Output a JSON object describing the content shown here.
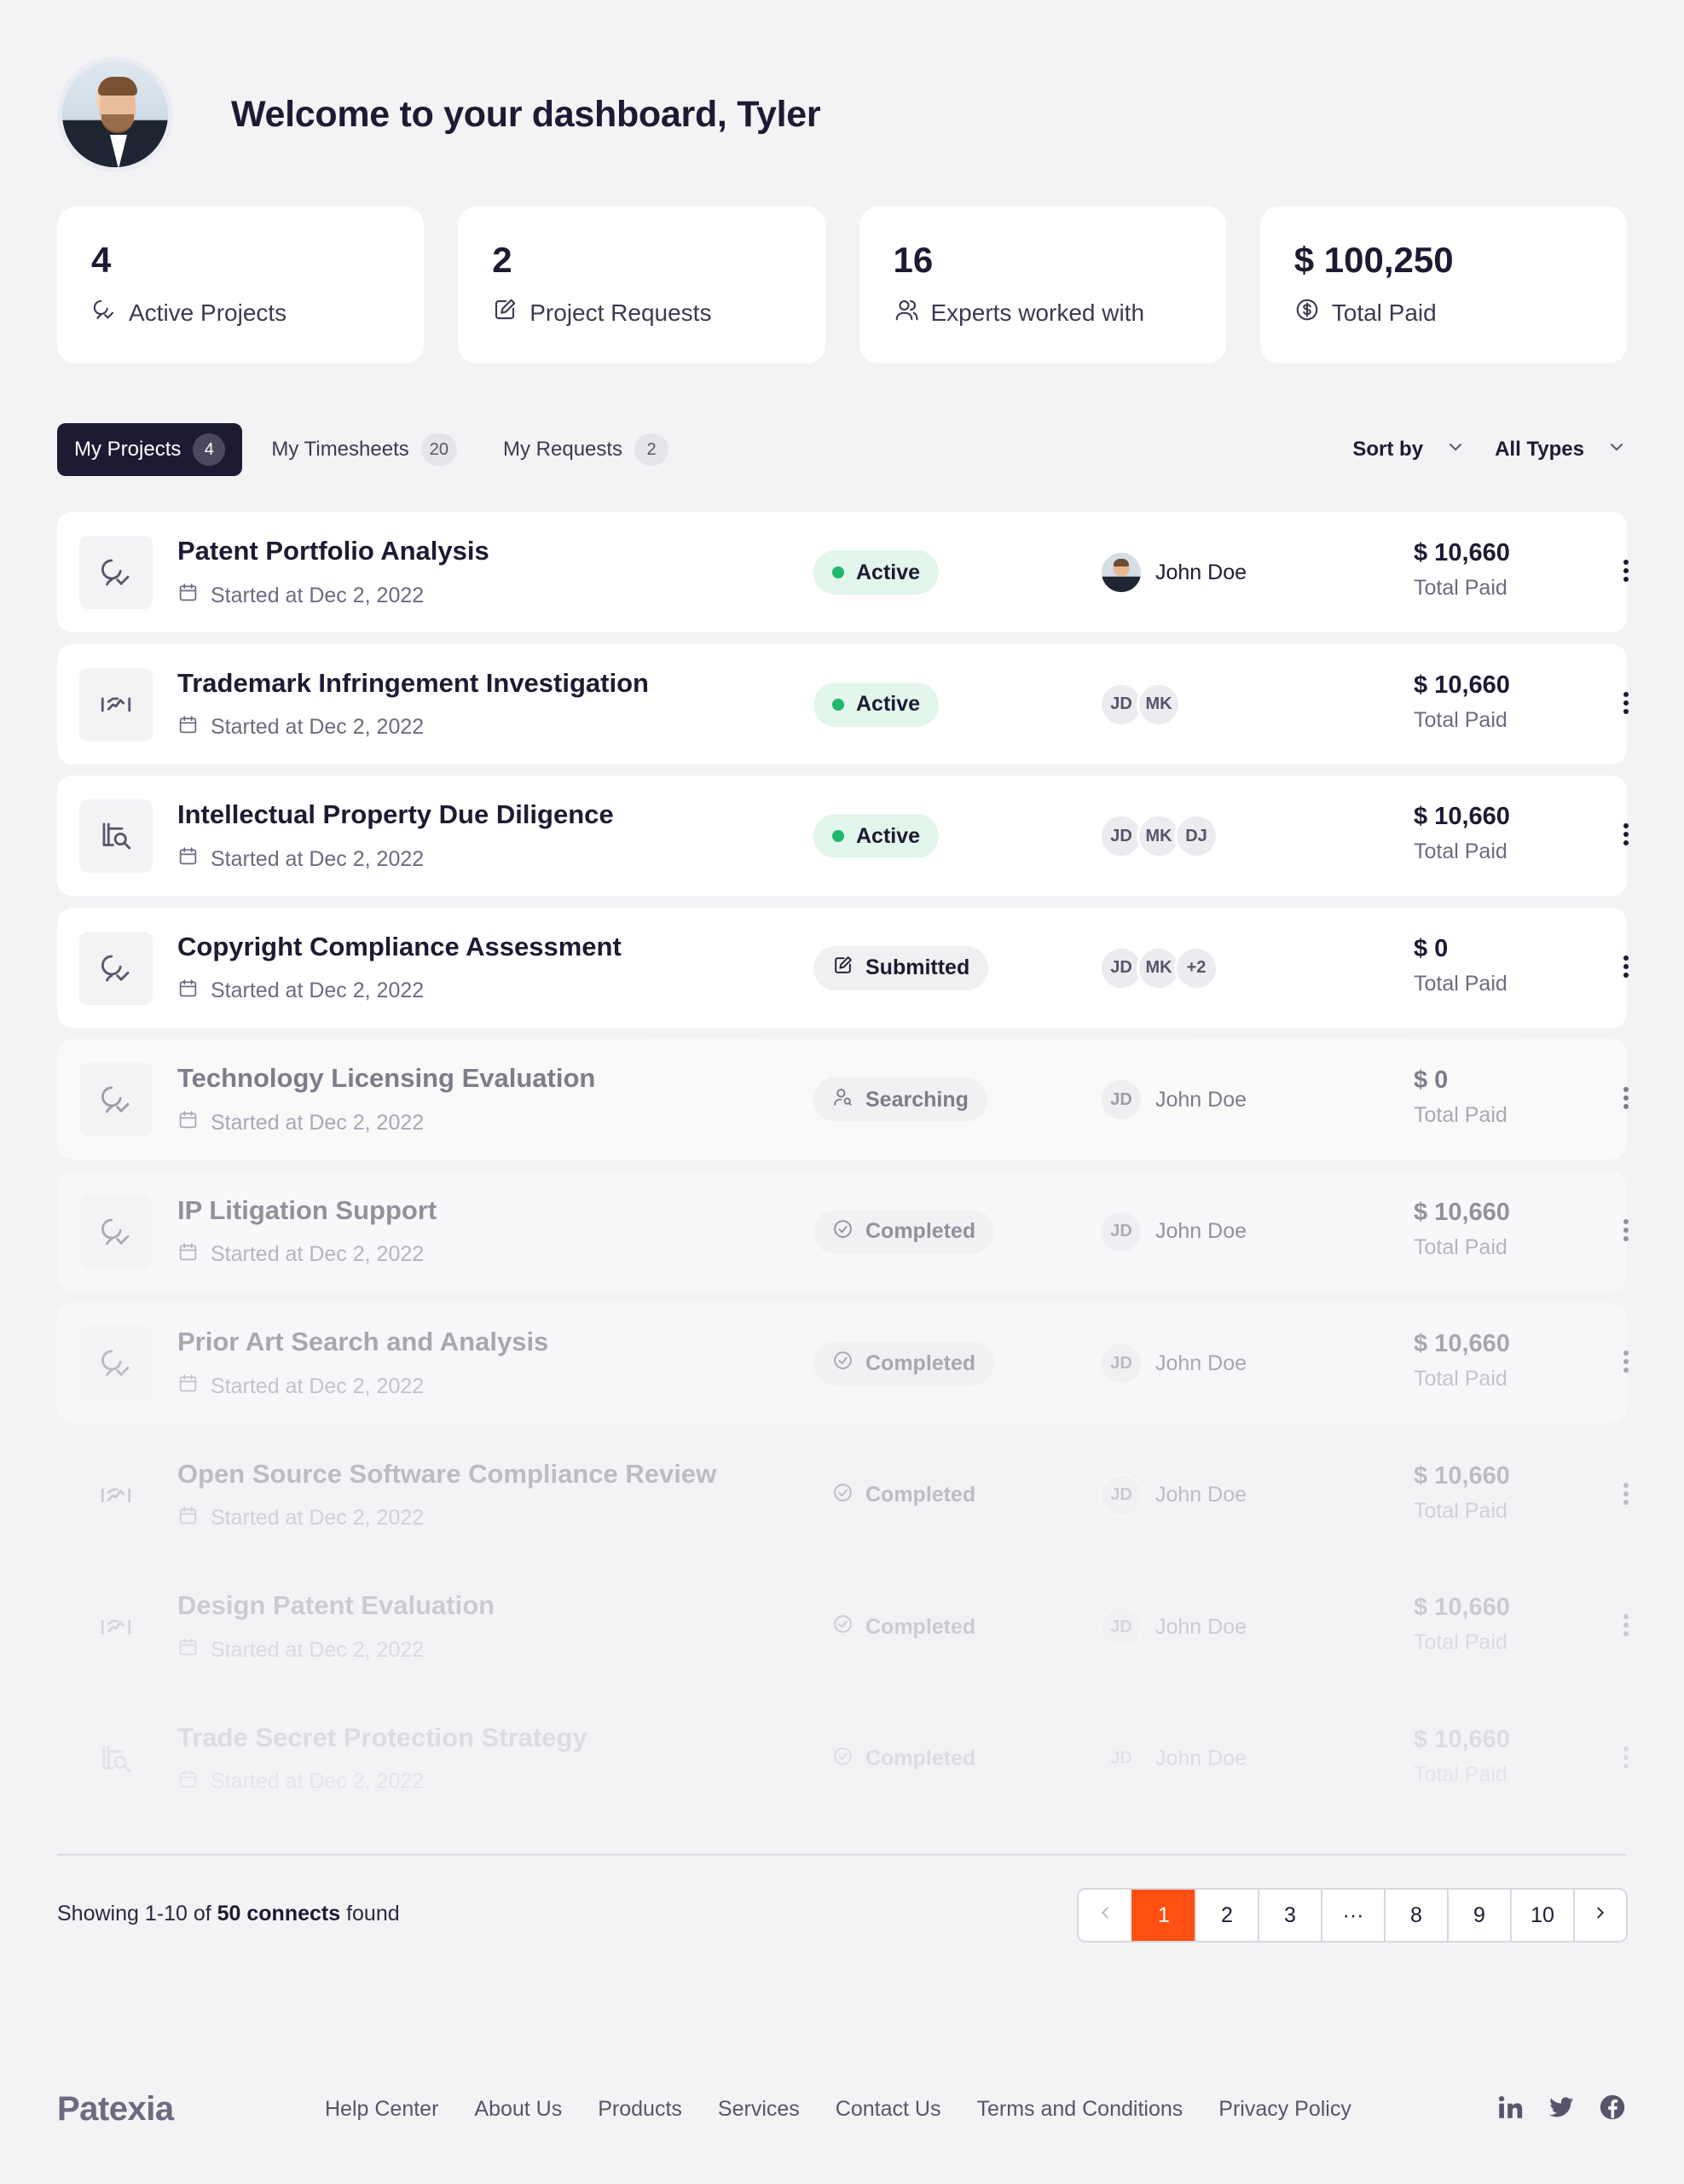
{
  "header": {
    "welcome": "Welcome to your dashboard, Tyler"
  },
  "stats": [
    {
      "value": "4",
      "label": "Active Projects",
      "icon": "project-icon"
    },
    {
      "value": "2",
      "label": "Project Requests",
      "icon": "request-icon"
    },
    {
      "value": "16",
      "label": "Experts worked with",
      "icon": "users-icon"
    },
    {
      "value": "$ 100,250",
      "label": "Total Paid",
      "icon": "dollar-icon"
    }
  ],
  "tabs": [
    {
      "label": "My Projects",
      "count": "4"
    },
    {
      "label": "My Timesheets",
      "count": "20"
    },
    {
      "label": "My Requests",
      "count": "2"
    }
  ],
  "filters": {
    "sort_label": "Sort by",
    "type_label": "All Types"
  },
  "projects": [
    {
      "title": "Patent Portfolio Analysis",
      "date": "Started at Dec 2, 2022",
      "status": "Active",
      "people": [],
      "person_name": "John Doe",
      "amount": "$ 10,660",
      "amount_label": "Total Paid"
    },
    {
      "title": "Trademark Infringement Investigation",
      "date": "Started at Dec 2, 2022",
      "status": "Active",
      "people": [
        "JD",
        "MK"
      ],
      "person_name": "",
      "amount": "$ 10,660",
      "amount_label": "Total Paid"
    },
    {
      "title": "Intellectual Property Due Diligence",
      "date": "Started at Dec 2, 2022",
      "status": "Active",
      "people": [
        "JD",
        "MK",
        "DJ"
      ],
      "person_name": "",
      "amount": "$ 10,660",
      "amount_label": "Total Paid"
    },
    {
      "title": "Copyright Compliance Assessment",
      "date": "Started at Dec 2, 2022",
      "status": "Submitted",
      "people": [
        "JD",
        "MK",
        "+2"
      ],
      "person_name": "",
      "amount": "$ 0",
      "amount_label": "Total Paid"
    },
    {
      "title": "Technology Licensing Evaluation",
      "date": "Started at Dec 2, 2022",
      "status": "Searching",
      "people": [
        "JD"
      ],
      "person_name": "John Doe",
      "amount": "$ 0",
      "amount_label": "Total Paid"
    },
    {
      "title": "IP Litigation Support",
      "date": "Started at Dec 2, 2022",
      "status": "Completed",
      "people": [
        "JD"
      ],
      "person_name": "John Doe",
      "amount": "$ 10,660",
      "amount_label": "Total Paid"
    },
    {
      "title": "Prior Art Search and Analysis",
      "date": "Started at Dec 2, 2022",
      "status": "Completed",
      "people": [
        "JD"
      ],
      "person_name": "John Doe",
      "amount": "$ 10,660",
      "amount_label": "Total Paid"
    },
    {
      "title": "Open Source Software Compliance Review",
      "date": "Started at Dec 2, 2022",
      "status": "Completed",
      "people": [
        "JD"
      ],
      "person_name": "John Doe",
      "amount": "$ 10,660",
      "amount_label": "Total Paid"
    },
    {
      "title": "Design Patent Evaluation",
      "date": "Started at Dec 2, 2022",
      "status": "Completed",
      "people": [
        "JD"
      ],
      "person_name": "John Doe",
      "amount": "$ 10,660",
      "amount_label": "Total Paid"
    },
    {
      "title": "Trade Secret Protection Strategy",
      "date": "Started at Dec 2, 2022",
      "status": "Completed",
      "people": [
        "JD"
      ],
      "person_name": "John Doe",
      "amount": "$ 10,660",
      "amount_label": "Total Paid"
    }
  ],
  "pagination": {
    "showing_prefix": "Showing 1-10 of ",
    "showing_bold": "50 connects",
    "showing_suffix": " found",
    "pages": [
      "1",
      "2",
      "3",
      "···",
      "8",
      "9",
      "10"
    ],
    "current": "1"
  },
  "footer": {
    "logo": "Patexia",
    "links": [
      "Help Center",
      "About Us",
      "Products",
      "Services",
      "Contact Us",
      "Terms and Conditions",
      "Privacy Policy"
    ],
    "socials": [
      "linkedin-icon",
      "twitter-icon",
      "facebook-icon"
    ]
  },
  "colors": {
    "accent": "#ff4f13",
    "dark": "#1c1b33",
    "active_dot": "#1fb86a",
    "active_bg": "#e2f6ec"
  }
}
